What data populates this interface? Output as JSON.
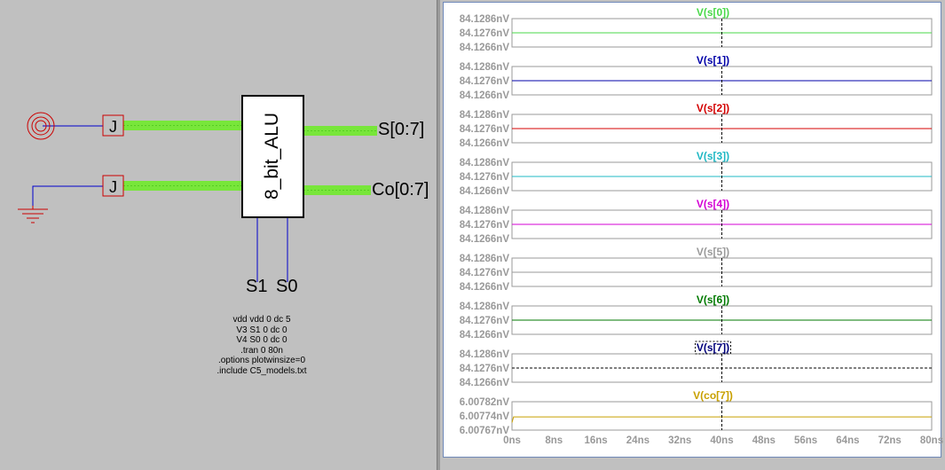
{
  "schematic": {
    "component_label": "8_bit_ALU",
    "port_labels": {
      "s_bus": "S[0:7]",
      "co_bus": "Co[0:7]",
      "s1": "S1",
      "s0": "S0"
    },
    "jumper_label": "J",
    "directives": [
      "vdd vdd 0 dc 5",
      "V3 S1 0 dc 0",
      "V4 S0 0 dc 0",
      ".tran 0 80n",
      ".options plotwinsize=0",
      ".include C5_models.txt"
    ]
  },
  "waveform_viewer": {
    "cursor_time": "40ns",
    "x_axis": {
      "ticks": [
        "0ns",
        "8ns",
        "16ns",
        "24ns",
        "32ns",
        "40ns",
        "48ns",
        "56ns",
        "64ns",
        "72ns",
        "80ns"
      ]
    },
    "colors": {
      "grid_border": "#9a9a9a",
      "tick_text": "#999999",
      "cursor": "#000000"
    }
  },
  "chart_data": [
    {
      "type": "line",
      "title": "V(s[0])",
      "color": "#4ad94a",
      "selected": false,
      "yticks": [
        "84.1286nV",
        "84.1276nV",
        "84.1266nV"
      ],
      "ylim": [
        84.1266,
        84.1286
      ],
      "x": [
        0,
        80
      ],
      "y": [
        84.1276,
        84.1276
      ]
    },
    {
      "type": "line",
      "title": "V(s[1])",
      "color": "#0000a8",
      "selected": false,
      "yticks": [
        "84.1286nV",
        "84.1276nV",
        "84.1266nV"
      ],
      "ylim": [
        84.1266,
        84.1286
      ],
      "x": [
        0,
        80
      ],
      "y": [
        84.1276,
        84.1276
      ]
    },
    {
      "type": "line",
      "title": "V(s[2])",
      "color": "#d40000",
      "selected": false,
      "yticks": [
        "84.1286nV",
        "84.1276nV",
        "84.1266nV"
      ],
      "ylim": [
        84.1266,
        84.1286
      ],
      "x": [
        0,
        80
      ],
      "y": [
        84.1276,
        84.1276
      ]
    },
    {
      "type": "line",
      "title": "V(s[3])",
      "color": "#1fb8c4",
      "selected": false,
      "yticks": [
        "84.1286nV",
        "84.1276nV",
        "84.1266nV"
      ],
      "ylim": [
        84.1266,
        84.1286
      ],
      "x": [
        0,
        80
      ],
      "y": [
        84.1276,
        84.1276
      ]
    },
    {
      "type": "line",
      "title": "V(s[4])",
      "color": "#d400d4",
      "selected": false,
      "yticks": [
        "84.1286nV",
        "84.1276nV",
        "84.1266nV"
      ],
      "ylim": [
        84.1266,
        84.1286
      ],
      "x": [
        0,
        80
      ],
      "y": [
        84.1276,
        84.1276
      ]
    },
    {
      "type": "line",
      "title": "V(s[5])",
      "color": "#9a9a9a",
      "selected": false,
      "yticks": [
        "84.1286nV",
        "84.1276nV",
        "84.1266nV"
      ],
      "ylim": [
        84.1266,
        84.1286
      ],
      "x": [
        0,
        80
      ],
      "y": [
        84.1276,
        84.1276
      ]
    },
    {
      "type": "line",
      "title": "V(s[6])",
      "color": "#007a00",
      "selected": false,
      "yticks": [
        "84.1286nV",
        "84.1276nV",
        "84.1266nV"
      ],
      "ylim": [
        84.1266,
        84.1286
      ],
      "x": [
        0,
        80
      ],
      "y": [
        84.1276,
        84.1276
      ]
    },
    {
      "type": "line",
      "title": "V(s[7])",
      "color": "#00007a",
      "selected": true,
      "yticks": [
        "84.1286nV",
        "84.1276nV",
        "84.1266nV"
      ],
      "ylim": [
        84.1266,
        84.1286
      ],
      "x": [
        0,
        80
      ],
      "y": [
        84.1276,
        84.1276
      ]
    },
    {
      "type": "line",
      "title": "V(co[7])",
      "color": "#c8a000",
      "selected": false,
      "yticks": [
        "6.00782nV",
        "6.00774nV",
        "6.00767nV"
      ],
      "ylim": [
        6.00767,
        6.00782
      ],
      "x": [
        0,
        0.3,
        80
      ],
      "y": [
        6.00771,
        6.00774,
        6.00774
      ]
    }
  ]
}
